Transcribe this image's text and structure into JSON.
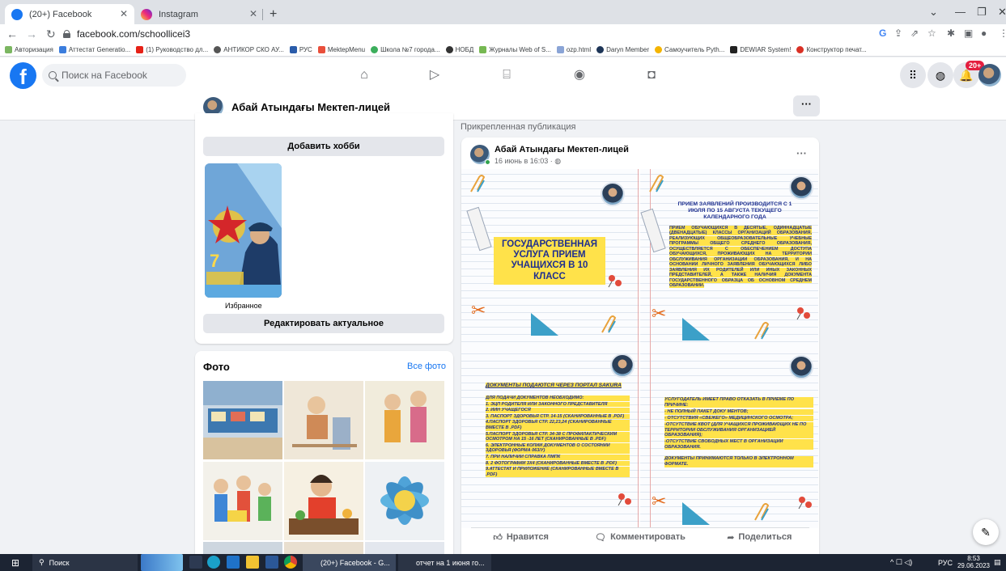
{
  "browser": {
    "tabs": [
      {
        "title": "(20+) Facebook",
        "active": true
      },
      {
        "title": "Instagram",
        "active": false
      }
    ],
    "url": "facebook.com/schoollicei3",
    "bookmarks": [
      "Авторизация",
      "Аттестат Generatio...",
      "(1) Руководство дл...",
      "АНТИКОР СКО АУ...",
      "РУС",
      "MektepMenu",
      "Школа №7 города...",
      "НОБД",
      "Журналы Web of S...",
      "ozp.html",
      "Daryn Member",
      "Самоучитель Pyth...",
      "DEWIAR System!",
      "Конструктор печат..."
    ]
  },
  "fb": {
    "search_placeholder": "Поиск на Facebook",
    "notifications_badge": "20+",
    "page_name": "Абай Атындағы Мектеп-лицей",
    "more_glyph": "···"
  },
  "left": {
    "add_hobby_button": "Добавить хобби",
    "highlight_label": "Избранное",
    "edit_featured_button": "Редактировать актуальное",
    "photos_title": "Фото",
    "all_photos_link": "Все фото"
  },
  "post": {
    "pinned_label": "Прикрепленная публикация",
    "author": "Абай Атындағы Мектеп-лицей",
    "time": "16 июнь в 16:03 ·",
    "q1_title": "ГОСУДАРСТВЕННАЯ УСЛУГА ПРИЕМ УЧАЩИХСЯ В 10 КЛАСС",
    "q2_heading": "ПРИЕМ ЗАЯВЛЕНИЙ ПРОИЗВОДИТСЯ С 1 ИЮЛЯ ПО 15 АВГУСТА ТЕКУЩЕГО КАЛЕНДАРНОГО ГОДА",
    "q2_body": "ПРИЕМ ОБУЧАЮЩИХСЯ В ДЕСЯТЫЕ, ОДИННАДЦАТЫЕ (ДВЕНАДЦАТЫЕ) КЛАССЫ ОРГАНИЗАЦИЙ ОБРАЗОВАНИЯ, РЕАЛИЗУЮЩИХ ОБЩЕОБРАЗОВАТЕЛЬНЫЕ УЧЕБНЫЕ ПРОГРАММЫ ОБЩЕГО СРЕДНЕГО ОБРАЗОВАНИЯ, ОСУЩЕСТВЛЯЕТСЯ С ОБЕСПЕЧЕНИЕМ ДОСТУПА ОБУЧАЮЩИХСЯ, ПРОЖИВАЮЩИХ НА ТЕРРИТОРИИ ОБСЛУЖИВАНИЯ ОРГАНИЗАЦИИ ОБРАЗОВАНИЯ, И НА ОСНОВАНИИ ЛИЧНОГО ЗАЯВЛЕНИЯ ОБУЧАЮЩИХСЯ ЛИБО ЗАЯВЛЕНИЯ ИХ РОДИТЕЛЕЙ ИЛИ ИНЫХ ЗАКОННЫХ ПРЕДСТАВИТЕЛЕЙ, А ТАКЖЕ НАЛИЧИЯ ДОКУМЕНТА ГОСУДАРСТВЕННОГО ОБРАЗЦА ОБ ОСНОВНОМ СРЕДНЕМ ОБРАЗОВАНИИ.",
    "q3_heading": "ДОКУМЕНТЫ ПОДАЮТСЯ ЧЕРЕЗ ПОРТАЛ SAKURA",
    "q3_lines": [
      "ДЛЯ ПОДАЧИ ДОКУМЕНТОВ НЕОБХОДИМО:",
      "1. ЭЦП РОДИТЕЛЯ ИЛИ ЗАКОННОГО ПРЕДСТАВИТЕЛЯ",
      "2. ИИН УЧАЩЕГОСЯ",
      "3. ПАСПОРТ ЗДОРОВЬЯ СТР. 14-15 (СКАНИРОВАННЫЕ В .PDF)",
      "4.ПАСПОРТ ЗДОРОВЬЯ СТР. 22,23,24 (СКАНИРОВАННЫЕ ВМЕСТЕ В .PDF)",
      "5.ПАСПОРТ ЗДОРОВЬЯ СТР. 34-38 С ПРОФИЛАКТИЧЕСКИМ ОСМОТРОМ НА 15 -16 ЛЕТ (СКАНИРОВАННЫЕ В .PDF)",
      "6. ЭЛЕКТРОННЫЕ КОПИИ ДОКУМЕНТОВ О СОСТОЯНИИ ЗДОРОВЬЯ (ФОРМА 063/У)",
      "7. ПРИ НАЛИЧИИ СПРАВКА ПМПК",
      "8. 2 ФОТОГРАФИИ 3Х4 (СКАНИРОВАННЫЕ ВМЕСТЕ В .PDF)",
      "9.АТТЕСТАТ И ПРИЛОЖЕНИЕ (СКАНИРОВАННЫЕ ВМЕСТЕ В .PDF)"
    ],
    "q4_lines": [
      "УСЛУГОДАТЕЛЬ ИМЕЕТ ПРАВО ОТКАЗАТЬ В ПРИЕМЕ ПО ПРИЧИНЕ:",
      "- НЕ ПОЛНЫЙ ПАКЕТ ДОКУ МЕНТОВ;",
      "- ОТСУТСТВИЯ «СВЕЖЕГО» МЕДИЦИНСКОГО ОСМОТРА;",
      "-ОТСУТСТВИЕ КВОТ (ДЛЯ УЧАЩИХСЯ ПРОЖИВАЮЩИХ НЕ ПО ТЕРРИТОРИИ ОБСЛУЖИВАНИЯ ОРГАНИЗАЦИЕЙ ОБРАЗОВАНИЯ);",
      "-ОТСУТСТВИЕ СВОБОДНЫХ МЕСТ В ОРГАНИЗАЦИИ ОБРАЗОВАНИЯ.",
      "ДОКУМЕНТЫ ПРИНИМАЮТСЯ ТОЛЬКО В ЭЛЕКТРОННОМ ФОРМАТЕ."
    ],
    "like": "Нравится",
    "comment": "Комментировать",
    "share": "Поделиться"
  },
  "taskbar": {
    "search": "Поиск",
    "task1": "(20+) Facebook - G...",
    "task2": "отчет на 1 июня го...",
    "lang": "РУС",
    "time": "8:53",
    "date": "29.06.2023"
  }
}
